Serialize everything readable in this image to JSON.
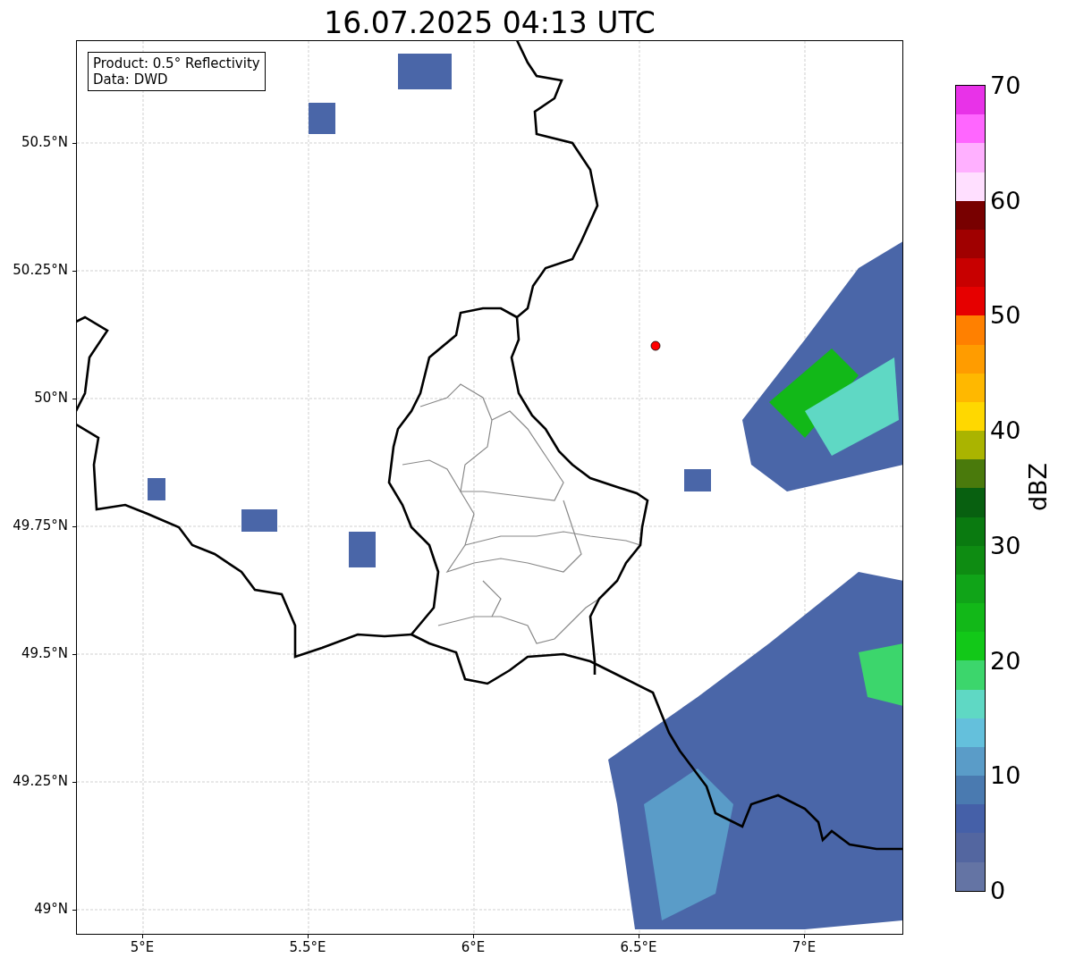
{
  "title": "16.07.2025 04:13 UTC",
  "map": {
    "info_box": [
      "Product: 0.5° Reflectivity",
      "Data: DWD"
    ],
    "y_ticks": [
      "50.5°N",
      "50.25°N",
      "50°N",
      "49.75°N",
      "49.5°N",
      "49.25°N",
      "49°N"
    ],
    "x_ticks": [
      "5°E",
      "5.5°E",
      "6°E",
      "6.5°E",
      "7°E"
    ]
  },
  "colorbar": {
    "label": "dBZ",
    "ticks": [
      "70",
      "60",
      "50",
      "40",
      "30",
      "20",
      "10",
      "0"
    ],
    "segments": [
      {
        "color": "#e832e8"
      },
      {
        "color": "#ff66ff"
      },
      {
        "color": "#ffb0ff"
      },
      {
        "color": "#ffdfff"
      },
      {
        "color": "#780000"
      },
      {
        "color": "#a00000"
      },
      {
        "color": "#c80000"
      },
      {
        "color": "#e60000"
      },
      {
        "color": "#ff8000"
      },
      {
        "color": "#ff9c00"
      },
      {
        "color": "#ffb800"
      },
      {
        "color": "#ffd800"
      },
      {
        "color": "#aab400"
      },
      {
        "color": "#4a7a0c"
      },
      {
        "color": "#086010"
      },
      {
        "color": "#0a7a10"
      },
      {
        "color": "#0e8c12"
      },
      {
        "color": "#10a418"
      },
      {
        "color": "#12b818"
      },
      {
        "color": "#12c818"
      },
      {
        "color": "#3cd66c"
      },
      {
        "color": "#5fd8c4"
      },
      {
        "color": "#64c0dc"
      },
      {
        "color": "#5a9cc8"
      },
      {
        "color": "#4a7ab0"
      },
      {
        "color": "#4560a8"
      },
      {
        "color": "#5366a0"
      },
      {
        "color": "#6474a4"
      }
    ]
  }
}
